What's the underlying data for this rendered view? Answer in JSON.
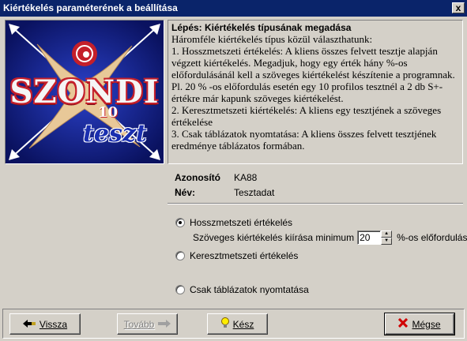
{
  "window": {
    "title": "Kiértékelés paraméterének a beállítása",
    "close_label": "x"
  },
  "logo": {
    "title": "SZONDI",
    "number": "10",
    "subtitle": "teszt"
  },
  "info": {
    "heading": "Lépés: Kiértékelés típusának megadása",
    "paragraphs": [
      "Háromféle kiértékelés típus közül választhatunk:",
      "1. Hosszmetszeti értékelés: A kliens összes felvett tesztje alapján végzett kiértékelés. Megadjuk, hogy egy érték hány %-os előfordulásánál kell a szöveges kiértékelést készítenie a programnak. Pl. 20 % -os előfordulás esetén egy 10 profilos tesztnél a 2 db S+- értékre már kapunk szöveges kiértékelést.",
      "2. Keresztmetszeti kiértékelés: A kliens egy tesztjének a szöveges értékelése",
      "3. Csak táblázatok nyomtatása: A kliens összes felvett tesztjének eredménye táblázatos formában."
    ]
  },
  "fields": {
    "id_label": "Azonosító :",
    "id_value": "KA88",
    "name_label": "Név:",
    "name_value": "Tesztadat"
  },
  "options": {
    "longitudinal": "Hosszmetszeti értékelés",
    "min_prefix": "Szöveges kiértékelés kiírása minimum",
    "min_value": "20",
    "min_suffix": "%-os előfordulásnál",
    "cross": "Keresztmetszeti értékelés",
    "tables": "Csak táblázatok nyomtatása",
    "selected": "longitudinal"
  },
  "buttons": {
    "back": "Vissza",
    "next": "Tovább",
    "done": "Kész",
    "cancel": "Mégse"
  },
  "colors": {
    "titlebar": "#0a246a",
    "face": "#d4d0c8",
    "logo_bg": "#0c1a78",
    "logo_red": "#c41f2a"
  }
}
